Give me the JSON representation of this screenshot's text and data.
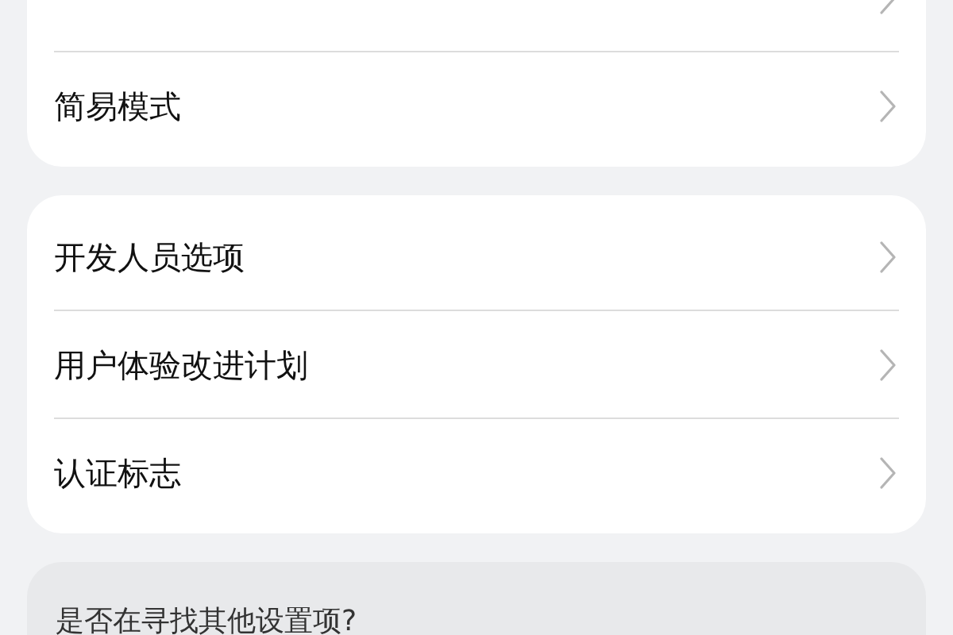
{
  "groups": [
    {
      "cut_top_row": true,
      "items": [
        {
          "label": "简易模式"
        }
      ]
    },
    {
      "items": [
        {
          "label": "开发人员选项"
        },
        {
          "label": "用户体验改进计划"
        },
        {
          "label": "认证标志"
        }
      ]
    }
  ],
  "hint": {
    "title": "是否在寻找其他设置项?"
  }
}
